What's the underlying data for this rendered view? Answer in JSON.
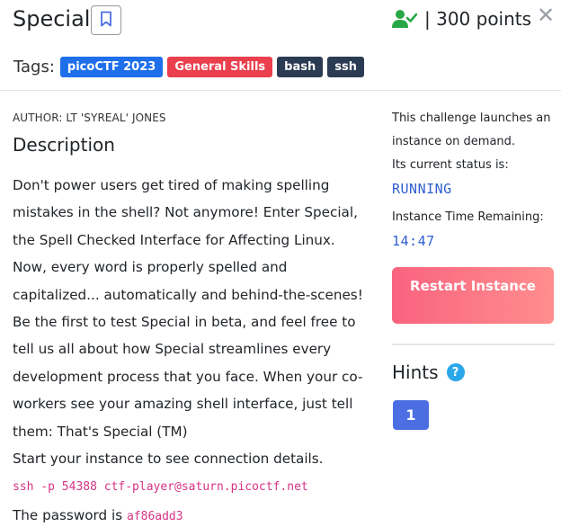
{
  "challenge": {
    "title": "Special",
    "points_text": "| 300 points",
    "close_symbol": "✕"
  },
  "tags": {
    "label": "Tags:",
    "items": [
      {
        "label": "picoCTF 2023",
        "color": "#1f6feb"
      },
      {
        "label": "General Skills",
        "color": "#ea3f4d"
      },
      {
        "label": "bash",
        "color": "#2b3b53"
      },
      {
        "label": "ssh",
        "color": "#2b3b53"
      }
    ]
  },
  "author": "AUTHOR: LT 'SYREAL' JONES",
  "description": {
    "title": "Description",
    "body": "Don't power users get tired of making spelling mistakes in the shell? Not anymore! Enter Special, the Spell Checked Interface for Affecting Linux. Now, every word is properly spelled and capitalized... automatically and behind-the-scenes! Be the first to test Special in beta, and feel free to tell us all about how Special streamlines every development process that you face. When your co-workers see your amazing shell interface, just tell them: That's Special (TM)",
    "instance_note": "Start your instance to see connection details.",
    "ssh_command": "ssh -p 54388 ctf-player@saturn.picoctf.net",
    "password_label": "The password is",
    "password": "af86add3"
  },
  "instance": {
    "launch_note": "This challenge launches an instance on demand.",
    "status_label": "Its current status is:",
    "status": "RUNNING",
    "time_label": "Instance Time Remaining:",
    "time_remaining": "14:47",
    "restart_label": "Restart Instance"
  },
  "hints": {
    "title": "Hints",
    "help_symbol": "?",
    "items": [
      "1"
    ]
  },
  "colors": {
    "solved": "#28a745",
    "status": "#2f5fd0",
    "code": "#d63384",
    "hint_button": "#4b6fe3",
    "help": "#2aa7e8"
  }
}
